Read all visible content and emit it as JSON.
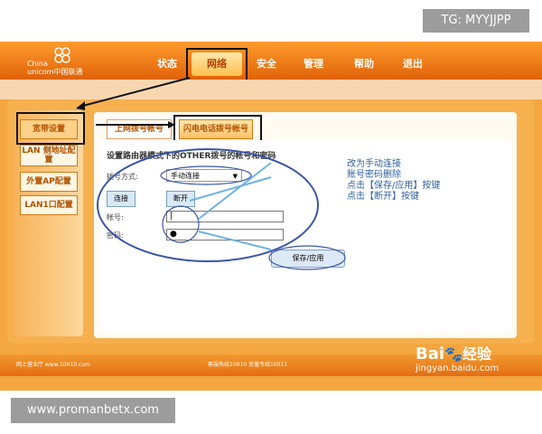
{
  "watermarks": {
    "top": "TG: MYYJJPP",
    "bottom": "www.promanbetx.com"
  },
  "brand": {
    "logo_line1": "China",
    "logo_line2": "unicom中国联通",
    "logo_icon": "unicom-knot-icon"
  },
  "nav": {
    "status": "状态",
    "network": "网络",
    "security": "安全",
    "manage": "管理",
    "help": "帮助",
    "logout": "退出"
  },
  "sidebar": {
    "items": [
      {
        "label": "宽带设置"
      },
      {
        "label": "LAN 侧地址配置"
      },
      {
        "label": "外置AP配置"
      },
      {
        "label": "LAN1口配置"
      }
    ]
  },
  "subtabs": {
    "internet_account": "上网拨号帐号",
    "other_dialup_account": "闪电电话拨号帐号"
  },
  "form": {
    "title": "设置路由器模式下的OTHER拨号的帐号和密码",
    "dial_mode_label": "拨号方式:",
    "dial_mode_value": "手动连接",
    "connect_label": "连接",
    "disconnect_label": "断开",
    "account_label": "帐号:",
    "account_value": "|",
    "password_label": "密码:",
    "password_value": "●",
    "save_apply_label": "保存/应用"
  },
  "notes": {
    "line1": "改为手动连接",
    "line2": "账号密码删除",
    "line3": "点击【保存/应用】按键",
    "line4": "点击【断开】按键"
  },
  "footer": {
    "left": "网上营业厅 www.10010.com",
    "middle": "客服热线10010  充值专线10011"
  },
  "baidu": {
    "brand": "Bai",
    "brand_suffix": "经验",
    "site": "jingyan.baidu.com"
  },
  "colors": {
    "orange": "#e06208",
    "panel": "#f6b04e",
    "note_blue": "#2f5f9c",
    "annotation_blue": "#3a55a8",
    "arrow_light": "#6fb3e0"
  }
}
